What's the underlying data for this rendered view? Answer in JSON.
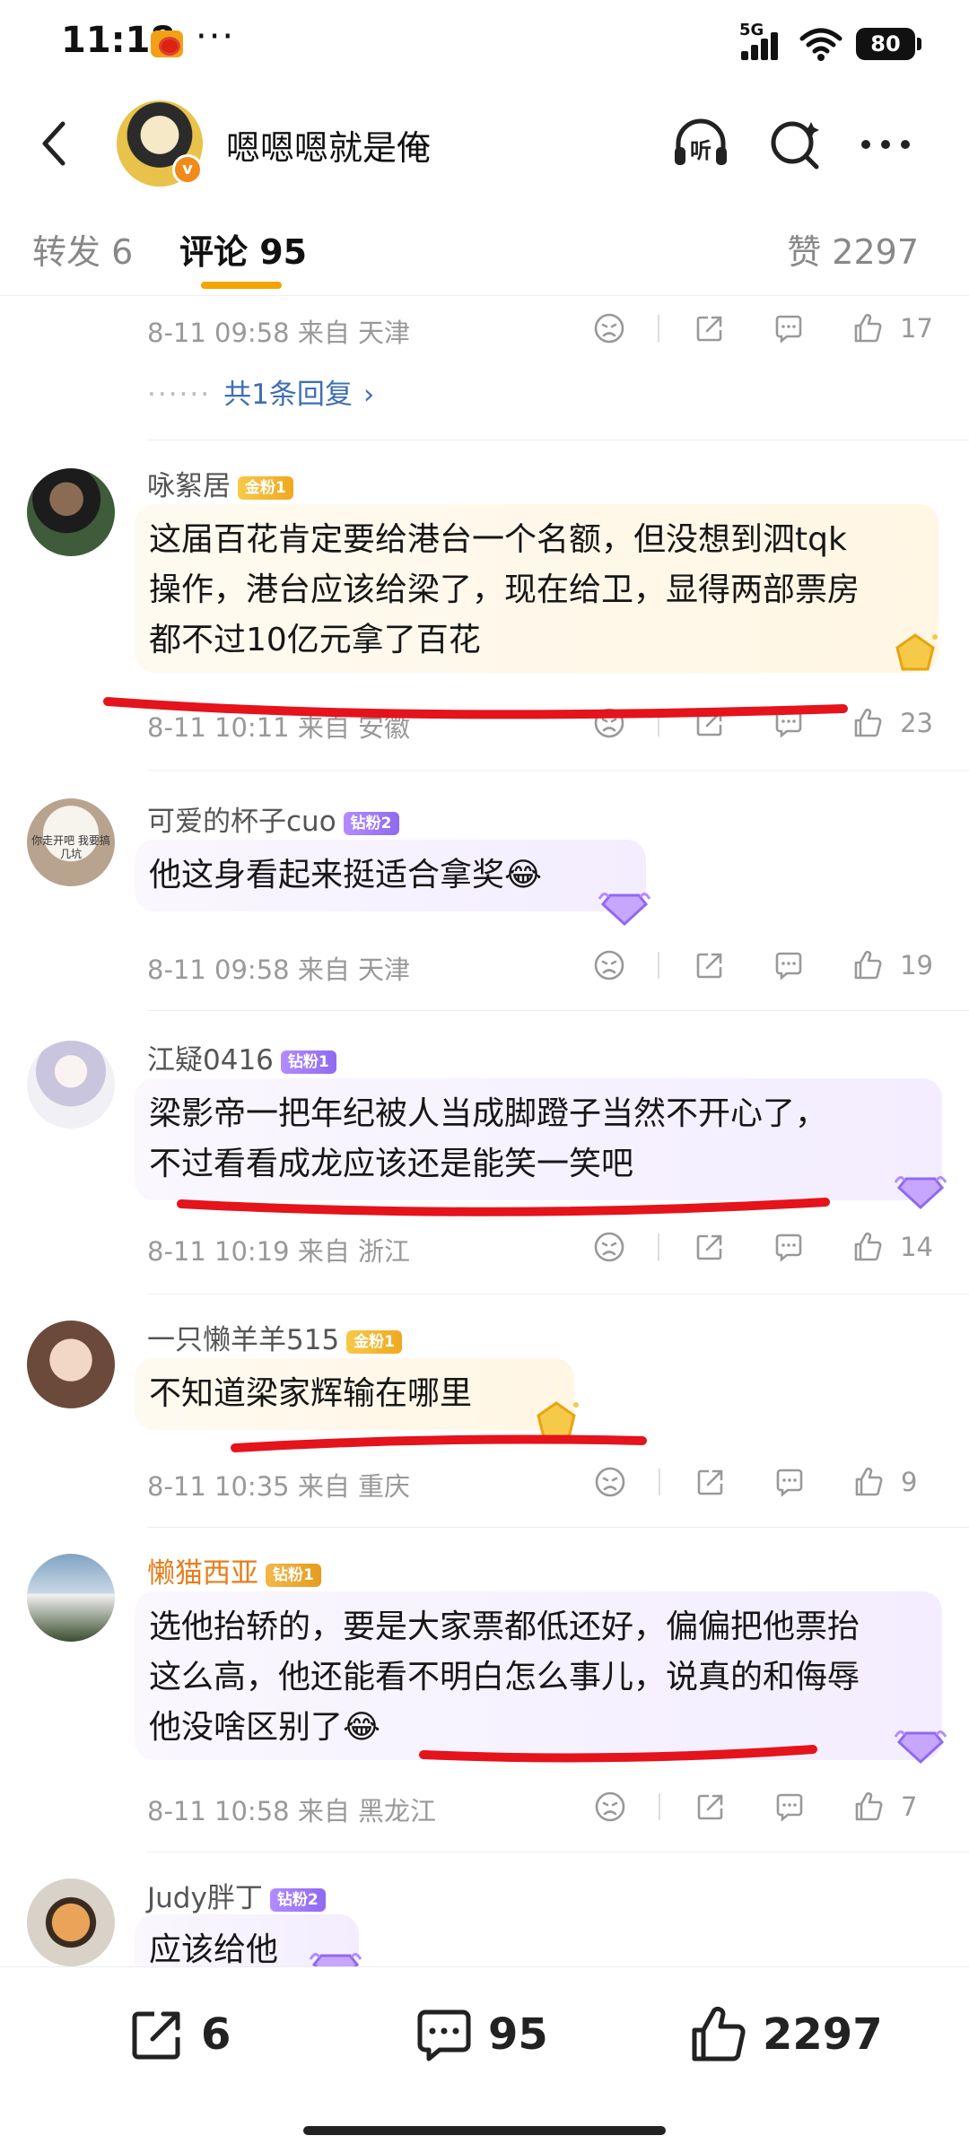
{
  "status_bar": {
    "time": "11:18",
    "dots": "···",
    "network": "5G",
    "battery": "80"
  },
  "header": {
    "title": "嗯嗯嗯就是俺",
    "badge": "v"
  },
  "tabs": {
    "repost": "转发 6",
    "comments": "评论 95",
    "likes": "赞 2297"
  },
  "top_comment": {
    "meta": "8-11 09:58 来自 天津",
    "likes": "17",
    "replies_label": "共1条回复"
  },
  "comments": [
    {
      "username": "咏絮居",
      "fan_badge": "金粉1",
      "text_lines": [
        "这届百花肯定要给港台一个名额，但没想到泗tqk",
        "操作，港台应该给梁了，现在给卫，显得两部票房",
        "都不过10亿元拿了百花"
      ],
      "meta": "8-11 10:11 来自 安徽",
      "likes": "23"
    },
    {
      "username": "可爱的杯子cuo",
      "fan_badge": "钻粉2",
      "avatar_text": "你走开吧 我要搞几坑",
      "text_lines": [
        "他这身看起来挺适合拿奖😂"
      ],
      "meta": "8-11 09:58 来自 天津",
      "likes": "19"
    },
    {
      "username": "江疑0416",
      "fan_badge": "钻粉1",
      "text_lines": [
        "梁影帝一把年纪被人当成脚蹬子当然不开心了，",
        "不过看看成龙应该还是能笑一笑吧"
      ],
      "meta": "8-11 10:19 来自 浙江",
      "likes": "14"
    },
    {
      "username": "一只懒羊羊515",
      "fan_badge": "金粉1",
      "text_lines": [
        "不知道梁家辉输在哪里"
      ],
      "meta": "8-11 10:35 来自 重庆",
      "likes": "9"
    },
    {
      "username": "懒猫西亚",
      "fan_badge": "钻粉1",
      "text_lines": [
        "选他抬轿的，要是大家票都低还好，偏偏把他票抬",
        "这么高，他还能看不明白怎么事儿，说真的和侮辱",
        "他没啥区别了😂"
      ],
      "meta": "8-11 10:58 来自 黑龙江",
      "likes": "7"
    },
    {
      "username": "Judy胖丁",
      "fan_badge": "钻粉2",
      "text_lines": [
        "应该给他"
      ]
    }
  ],
  "bottom_bar": {
    "reposts": "6",
    "comments": "95",
    "likes": "2297"
  },
  "colors": {
    "accent": "#f4a300",
    "red_mark": "#e4131c",
    "gold_bg": "#fff7e8",
    "purple_bg": "#f4eeff",
    "vip_orange": "#e87d1c"
  }
}
